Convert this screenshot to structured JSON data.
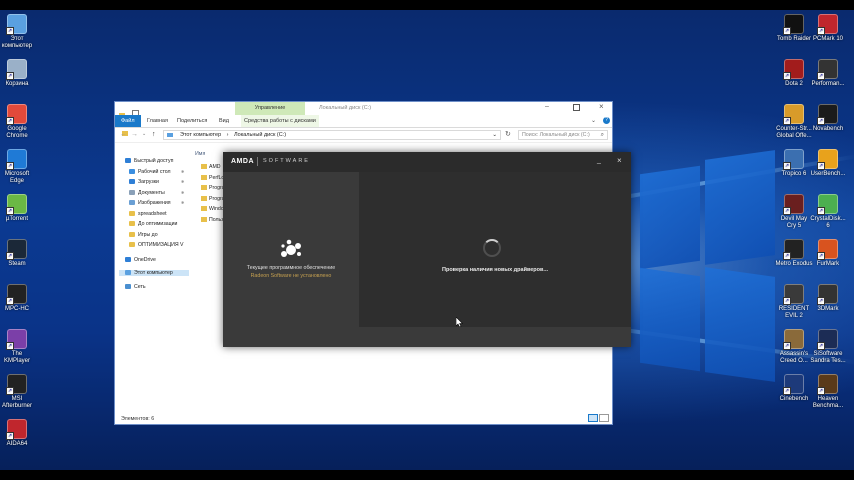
{
  "desktop_left": [
    {
      "label": "Этот\nкомпьютер",
      "icon": "computer-icon",
      "color": "#5aa0e0"
    },
    {
      "label": "Корзина",
      "icon": "recycle-bin-icon",
      "color": "#9ab0c8"
    },
    {
      "label": "Google\nChrome",
      "icon": "chrome-icon",
      "color": "#e24a3b"
    },
    {
      "label": "Microsoft\nEdge",
      "icon": "edge-icon",
      "color": "#1f7ad6"
    },
    {
      "label": "µTorrent",
      "icon": "utorrent-icon",
      "color": "#6bb845"
    },
    {
      "label": "Steam",
      "icon": "steam-icon",
      "color": "#1b2838"
    },
    {
      "label": "MPC-HC",
      "icon": "mpc-hc-icon",
      "color": "#222"
    },
    {
      "label": "The\nKMPlayer",
      "icon": "kmplayer-icon",
      "color": "#7b3fa8"
    },
    {
      "label": "MSI\nAfterburner",
      "icon": "afterburner-icon",
      "color": "#222"
    },
    {
      "label": "AIDA64",
      "icon": "aida64-icon",
      "color": "#c0262d"
    }
  ],
  "desktop_right": [
    {
      "label": "Tomb Raider",
      "icon": "tomb-raider-icon",
      "color": "#111"
    },
    {
      "label": "PCMark 10",
      "icon": "pcmark-icon",
      "color": "#c0262d"
    },
    {
      "label": "Dota 2",
      "icon": "dota2-icon",
      "color": "#a21c1c"
    },
    {
      "label": "Performan...",
      "icon": "performance-icon",
      "color": "#333"
    },
    {
      "label": "Counter-Str...\nGlobal Offe...",
      "icon": "csgo-icon",
      "color": "#d89b2a"
    },
    {
      "label": "Novabench",
      "icon": "novabench-icon",
      "color": "#1b1b1b"
    },
    {
      "label": "Tropico 6",
      "icon": "tropico-icon",
      "color": "#3b6fb0"
    },
    {
      "label": "UserBench...",
      "icon": "userbench-icon",
      "color": "#e8a21c"
    },
    {
      "label": "Devil May\nCry 5",
      "icon": "dmc5-icon",
      "color": "#6a1f1f"
    },
    {
      "label": "CrystalDisk...\n6",
      "icon": "crystaldisk-icon",
      "color": "#4caf50"
    },
    {
      "label": "Metro Exodus",
      "icon": "metro-icon",
      "color": "#222"
    },
    {
      "label": "FurMark",
      "icon": "furmark-icon",
      "color": "#d8531f"
    },
    {
      "label": "RESIDENT\nEVIL 2",
      "icon": "re2-icon",
      "color": "#3a3a3a"
    },
    {
      "label": "3DMark",
      "icon": "3dmark-icon",
      "color": "#333"
    },
    {
      "label": "Assassin's\nCreed O...",
      "icon": "acorigins-icon",
      "color": "#8a6a3a"
    },
    {
      "label": "SiSoftware\nSandra Tes...",
      "icon": "sandra-icon",
      "color": "#1c2c55"
    },
    {
      "label": "Cinebench",
      "icon": "cinebench-icon",
      "color": "#1d3a7a"
    },
    {
      "label": "Heaven\nBenchma...",
      "icon": "heaven-icon",
      "color": "#5a3a1a"
    }
  ],
  "explorer": {
    "title": "Локальный диск (C:)",
    "contextual_tab": "Управление",
    "tabs": [
      "Файл",
      "Главная",
      "Поделиться",
      "Вид",
      "Средства работы с дисками"
    ],
    "breadcrumb": [
      "Этот компьютер",
      "Локальный диск (C:)"
    ],
    "search_placeholder": "Поиск: Локальный диск (C:)",
    "column_header": "Имя",
    "nav": [
      {
        "label": "Быстрый доступ",
        "icon": "star-icon",
        "color": "#2f7fd6",
        "indent": 0
      },
      {
        "label": "Рабочий стол",
        "icon": "desktop-icon",
        "color": "#3a8ee0",
        "indent": 1,
        "pinned": true
      },
      {
        "label": "Загрузки",
        "icon": "download-icon",
        "color": "#2f7fd6",
        "indent": 1,
        "pinned": true
      },
      {
        "label": "Документы",
        "icon": "documents-icon",
        "color": "#8aa0b8",
        "indent": 1,
        "pinned": true
      },
      {
        "label": "Изображения",
        "icon": "pictures-icon",
        "color": "#6a9fd4",
        "indent": 1,
        "pinned": true
      },
      {
        "label": "spreadsheet",
        "icon": "folder-icon",
        "color": "#e8c04a",
        "indent": 1
      },
      {
        "label": "До оптимизации",
        "icon": "folder-icon",
        "color": "#e8c04a",
        "indent": 1
      },
      {
        "label": "Игры до",
        "icon": "folder-icon",
        "color": "#e8c04a",
        "indent": 1
      },
      {
        "label": "ОПТИМИЗАЦИЯ V",
        "icon": "folder-icon",
        "color": "#e8c04a",
        "indent": 1
      },
      {
        "label": "OneDrive",
        "icon": "onedrive-icon",
        "color": "#2f7fd6",
        "indent": 0
      },
      {
        "label": "Этот компьютер",
        "icon": "computer-icon",
        "color": "#5aa0e0",
        "indent": 0,
        "selected": true
      },
      {
        "label": "Сеть",
        "icon": "network-icon",
        "color": "#4a8fd0",
        "indent": 0
      }
    ],
    "folders": [
      "AMD",
      "PerfLogs",
      "Program",
      "Program",
      "Windows",
      "Пользов"
    ],
    "status": "Элементов: 6"
  },
  "amd": {
    "brand": "AMDA",
    "product": "SOFTWARE",
    "current_label": "Текущее программное обеспечение",
    "current_value": "Radeon Software не установлено",
    "status": "Проверка наличия новых драйверов..."
  },
  "colors": {
    "accent": "#1979ca",
    "amd_bg": "#3a3a3a",
    "amd_panel": "#2e2e2e",
    "amd_text_dim": "#c5a050"
  }
}
